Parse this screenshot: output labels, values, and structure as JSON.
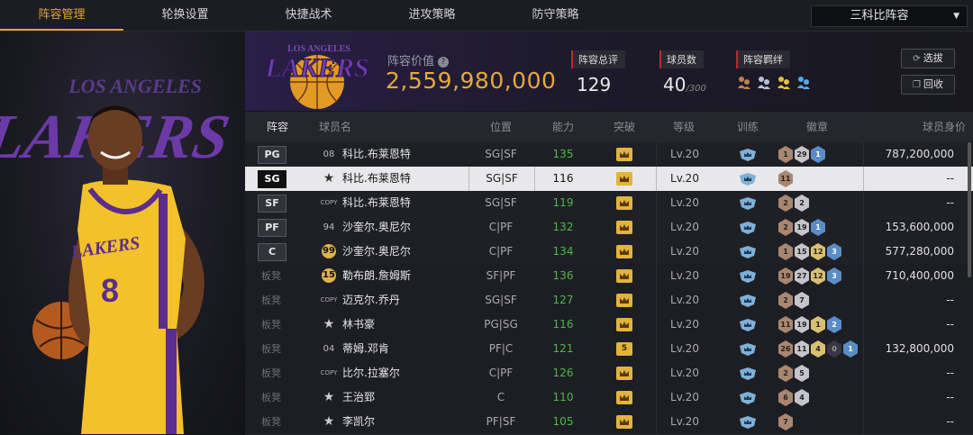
{
  "tabs": [
    {
      "label": "阵容管理",
      "active": true
    },
    {
      "label": "轮换设置",
      "active": false
    },
    {
      "label": "快捷战术",
      "active": false
    },
    {
      "label": "进攻策略",
      "active": false
    },
    {
      "label": "防守策略",
      "active": false
    }
  ],
  "lineup_select": {
    "value": "三科比阵容"
  },
  "header": {
    "logo_text": "LAKERS",
    "logo_top_text": "LOS ANGELES",
    "value_label": "阵容价值",
    "value": "2,559,980,000",
    "rating_label": "阵容总评",
    "rating": "129",
    "players_label": "球员数",
    "players": "40",
    "players_max": "/300",
    "bond_label": "阵容羁绊",
    "btn_pick": "选拔",
    "btn_return": "回收"
  },
  "hero": {
    "jersey_team": "LAKERS",
    "jersey_number": "8",
    "bg_text": "LAKERS",
    "bg_top_text": "LOS ANGELES"
  },
  "table": {
    "headers": [
      "阵容",
      "球员名",
      "位置",
      "能力",
      "突破",
      "等级",
      "训练",
      "徽章",
      "球员身价"
    ],
    "rows": [
      {
        "slot": "PG",
        "starter": true,
        "num": "08",
        "num_type": "plain",
        "name": "科比.布莱恩特",
        "pos": "SG|SF",
        "ability": "135",
        "breakthrough": "",
        "level": "Lv.20",
        "badges": [
          [
            "b",
            "1"
          ],
          [
            "s",
            "29"
          ],
          [
            "p",
            "1"
          ]
        ],
        "salary": "787,200,000"
      },
      {
        "slot": "SG",
        "starter": true,
        "selected": true,
        "num": "★",
        "num_type": "star",
        "name": "科比.布莱恩特",
        "pos": "SG|SF",
        "ability": "116",
        "breakthrough": "",
        "level": "Lv.20",
        "badges": [
          [
            "b",
            "11"
          ]
        ],
        "salary": "--"
      },
      {
        "slot": "SF",
        "starter": true,
        "num": "COPY",
        "num_type": "copy",
        "name": "科比.布莱恩特",
        "pos": "SG|SF",
        "ability": "119",
        "breakthrough": "",
        "level": "Lv.20",
        "badges": [
          [
            "b",
            "2"
          ],
          [
            "s",
            "2"
          ]
        ],
        "salary": "--"
      },
      {
        "slot": "PF",
        "starter": true,
        "num": "94",
        "num_type": "plain",
        "name": "沙奎尔.奥尼尔",
        "pos": "C|PF",
        "ability": "132",
        "breakthrough": "",
        "level": "Lv.20",
        "badges": [
          [
            "b",
            "2"
          ],
          [
            "s",
            "19"
          ],
          [
            "p",
            "1"
          ]
        ],
        "salary": "153,600,000"
      },
      {
        "slot": "C",
        "starter": true,
        "num": "99",
        "num_type": "gold",
        "name": "沙奎尔.奥尼尔",
        "pos": "C|PF",
        "ability": "134",
        "breakthrough": "",
        "level": "Lv.20",
        "badges": [
          [
            "b",
            "1"
          ],
          [
            "s",
            "15"
          ],
          [
            "g",
            "12"
          ],
          [
            "p",
            "3"
          ]
        ],
        "salary": "577,280,000"
      },
      {
        "slot": "板凳",
        "starter": false,
        "num": "15",
        "num_type": "gold",
        "name": "勒布朗.詹姆斯",
        "pos": "SF|PF",
        "ability": "136",
        "breakthrough": "",
        "level": "Lv.20",
        "badges": [
          [
            "b",
            "19"
          ],
          [
            "s",
            "27"
          ],
          [
            "g",
            "12"
          ],
          [
            "p",
            "3"
          ]
        ],
        "salary": "710,400,000"
      },
      {
        "slot": "板凳",
        "starter": false,
        "num": "COPY",
        "num_type": "copy",
        "name": "迈克尔.乔丹",
        "pos": "SG|SF",
        "ability": "127",
        "breakthrough": "",
        "level": "Lv.20",
        "badges": [
          [
            "b",
            "2"
          ],
          [
            "s",
            "7"
          ]
        ],
        "salary": "--"
      },
      {
        "slot": "板凳",
        "starter": false,
        "num": "★",
        "num_type": "star",
        "name": "林书豪",
        "pos": "PG|SG",
        "ability": "116",
        "breakthrough": "",
        "level": "Lv.20",
        "badges": [
          [
            "b",
            "11"
          ],
          [
            "s",
            "19"
          ],
          [
            "g",
            "1"
          ],
          [
            "p",
            "2"
          ]
        ],
        "salary": "--"
      },
      {
        "slot": "板凳",
        "starter": false,
        "num": "04",
        "num_type": "plain",
        "name": "蒂姆.邓肯",
        "pos": "PF|C",
        "ability": "121",
        "breakthrough": "5",
        "level": "Lv.20",
        "badges": [
          [
            "b",
            "26"
          ],
          [
            "s",
            "11"
          ],
          [
            "g",
            "4"
          ],
          [
            "d",
            "0"
          ],
          [
            "p",
            "1"
          ]
        ],
        "salary": "132,800,000"
      },
      {
        "slot": "板凳",
        "starter": false,
        "num": "COPY",
        "num_type": "copy",
        "name": "比尔.拉塞尔",
        "pos": "C|PF",
        "ability": "126",
        "breakthrough": "",
        "level": "Lv.20",
        "badges": [
          [
            "b",
            "2"
          ],
          [
            "s",
            "5"
          ]
        ],
        "salary": "--"
      },
      {
        "slot": "板凳",
        "starter": false,
        "num": "★",
        "num_type": "star",
        "name": "王治郅",
        "pos": "C",
        "ability": "110",
        "breakthrough": "",
        "level": "Lv.20",
        "badges": [
          [
            "b",
            "6"
          ],
          [
            "s",
            "4"
          ]
        ],
        "salary": "--"
      },
      {
        "slot": "板凳",
        "starter": false,
        "num": "★",
        "num_type": "star",
        "name": "李凯尔",
        "pos": "PF|SF",
        "ability": "105",
        "breakthrough": "",
        "level": "Lv.20",
        "badges": [
          [
            "b",
            "7"
          ]
        ],
        "salary": "--"
      }
    ]
  },
  "colors": {
    "accent": "#e0a536",
    "ability_green": "#4cb84a",
    "purple": "#5a2d8c",
    "red_marker": "#c0282e"
  },
  "icons": {
    "help": "help-icon",
    "dropdown": "chevron-down-icon",
    "pick": "refresh-icon",
    "return": "copy-icon",
    "training": "crown-shield-icon",
    "breakthrough": "crown-icon"
  }
}
